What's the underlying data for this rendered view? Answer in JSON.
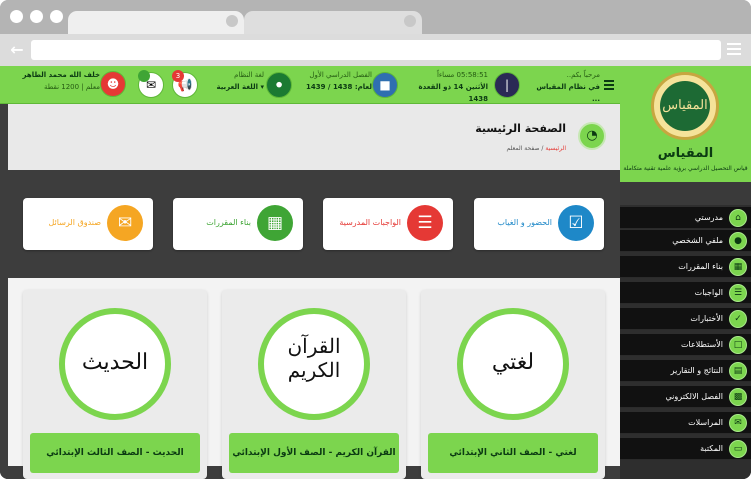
{
  "header": {
    "greeting": "مرحباً بكم..",
    "system_name": "في نظام المقياس ...",
    "time_label": "مساءاً",
    "time": "05:58:51",
    "date": "الأثنين 14 ذو القعدة 1438",
    "semester_label": "الفصل الدراسي الأول",
    "year_label": "لعام: 1438 / 1439",
    "language_label": "لغة النظام",
    "language_value": "اللغة العربية",
    "notification_count": "3",
    "user_name": "خلف الله محمد الطاهر",
    "user_role": "معلم",
    "user_points": "1200 نقطة"
  },
  "brand": {
    "name": "المقياس",
    "logo_text": "المقياس",
    "tagline": "قياس التحصيل الدراسي برؤية علمية تقنية متكاملة"
  },
  "sidebar": {
    "items": [
      {
        "label": "مدرستي",
        "icon": "school-icon"
      },
      {
        "label": "ملفي الشخصي",
        "icon": "profile-icon"
      },
      {
        "label": "بناء المقررات",
        "icon": "courses-icon"
      },
      {
        "label": "الواجبات",
        "icon": "homework-icon"
      },
      {
        "label": "الأختبارات",
        "icon": "exams-icon"
      },
      {
        "label": "الأستطلاعات",
        "icon": "surveys-icon"
      },
      {
        "label": "النتائج و التقارير",
        "icon": "reports-icon"
      },
      {
        "label": "الفصل الالكتروني",
        "icon": "eclass-icon"
      },
      {
        "label": "المراسلات",
        "icon": "messages-icon"
      },
      {
        "label": "المكتبة",
        "icon": "library-icon"
      }
    ]
  },
  "page": {
    "title": "الصفحة الرئيسية",
    "breadcrumb_home": "الرئيسية",
    "breadcrumb_sep": "/",
    "breadcrumb_current": "صفحة المعلم"
  },
  "quick_links": [
    {
      "label": "الحضور و الغياب",
      "color": "#1e88c8"
    },
    {
      "label": "الواجبات المدرسية",
      "color": "#e53935"
    },
    {
      "label": "بناء المقررات",
      "color": "#3fa535"
    },
    {
      "label": "صندوق الرسائل",
      "color": "#f5a623"
    }
  ],
  "courses": [
    {
      "ring_text": "لغتي",
      "button": "لغتي - الصف الثاني الإبتدائي"
    },
    {
      "ring_text_1": "القرآن",
      "ring_text_2": "الكريم",
      "button": "القرآن الكريم - الصف الأول الإبتدائي"
    },
    {
      "ring_text": "الحديث",
      "button": "الحديث - الصف الثالث الإبتدائي"
    }
  ],
  "colors": {
    "accent": "#7cd54e",
    "dark": "#111111"
  }
}
